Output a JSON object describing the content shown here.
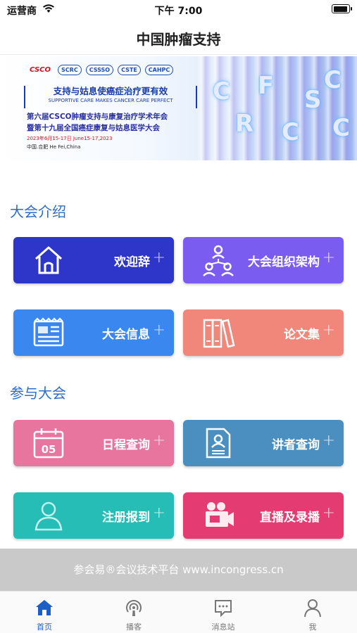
{
  "status_bar": {
    "carrier": "运营商",
    "time": "下午 7:00"
  },
  "header": {
    "title": "中国肿瘤支持"
  },
  "banner": {
    "logos": [
      "CSCO",
      "SCRC",
      "CSSSO",
      "CSTE",
      "CAHPC"
    ],
    "slogan": "支持与姑息使癌症治疗更有效",
    "slogan_en": "SUPPORTIVE CARE MAKES CANCER CARE PERFECT",
    "line1": "第六届CSCO肿瘤支持与康复治疗学术年会",
    "line2": "暨第十九届全国癌症康复与姑息医学大会",
    "date": "2023年6月15-17日 June15-17,2023",
    "place": "中国.合肥  He Fei,China",
    "letters": [
      "C",
      "R",
      "F",
      "C",
      "S",
      "C",
      "C"
    ]
  },
  "sections": [
    {
      "title": "大会介绍",
      "tiles": [
        {
          "label": "欢迎辞",
          "icon": "home-icon",
          "color": "#2d36c8"
        },
        {
          "label": "大会组织架构",
          "icon": "org-chart-icon",
          "color": "#7b5cf0"
        },
        {
          "label": "大会信息",
          "icon": "news-icon",
          "color": "#3a87f0"
        },
        {
          "label": "论文集",
          "icon": "books-icon",
          "color": "#f0877a"
        }
      ]
    },
    {
      "title": "参与大会",
      "tiles": [
        {
          "label": "日程查询",
          "icon": "calendar-icon",
          "color": "#e8759e",
          "calendar_day": "05"
        },
        {
          "label": "讲者查询",
          "icon": "speaker-card-icon",
          "color": "#4a8fc0"
        },
        {
          "label": "注册报到",
          "icon": "person-icon",
          "color": "#25bdb6"
        },
        {
          "label": "直播及录播",
          "icon": "camera-icon",
          "color": "#e33b72"
        }
      ]
    }
  ],
  "tile_plus": "+",
  "footer": {
    "text": "参会易®会议技术平台    www.incongress.cn"
  },
  "tabbar": [
    {
      "label": "首页",
      "icon": "home-icon",
      "active": true
    },
    {
      "label": "播客",
      "icon": "podcast-icon",
      "active": false
    },
    {
      "label": "消息站",
      "icon": "message-icon",
      "active": false
    },
    {
      "label": "我",
      "icon": "user-icon",
      "active": false
    }
  ],
  "colors": {
    "accent": "#1b5fc4",
    "section_title": "#2d6dc8",
    "tab_inactive": "#777777"
  }
}
